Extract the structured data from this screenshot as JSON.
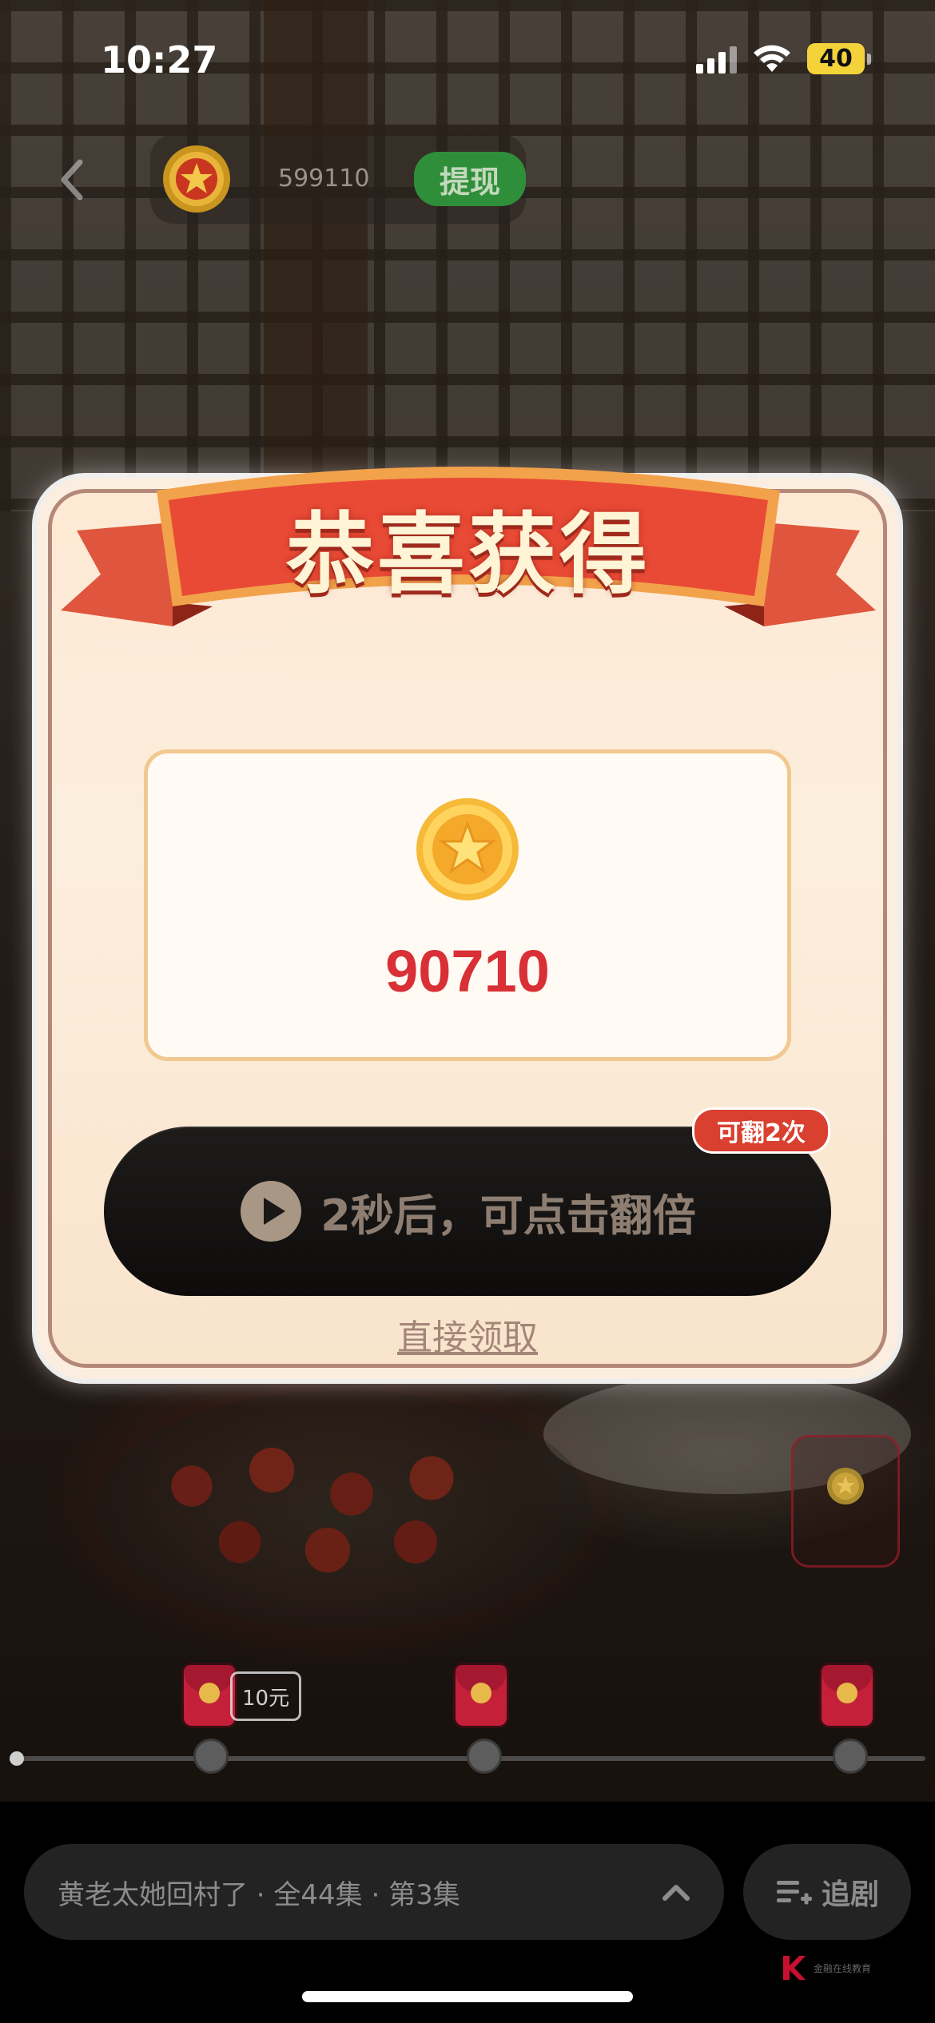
{
  "status_bar": {
    "time": "10:27",
    "battery": "40"
  },
  "header": {
    "coin_count": "599110",
    "withdraw_label": "提现"
  },
  "modal": {
    "title": "恭喜获得",
    "reward_amount": "90710",
    "double_button_label": "2秒后，可点击翻倍",
    "flip_badge": "可翻2次",
    "direct_claim_label": "直接领取"
  },
  "progress": {
    "cash_tag": "10元"
  },
  "bottom": {
    "series_info": "黄老太她回村了 · 全44集 · 第3集",
    "follow_label": "追剧",
    "watermark_text": "金融在线教育"
  },
  "colors": {
    "accent_red": "#d83036",
    "withdraw_green": "#2f8e3a",
    "ribbon_red": "#e94a35",
    "modal_bg": "#fbeee0"
  }
}
